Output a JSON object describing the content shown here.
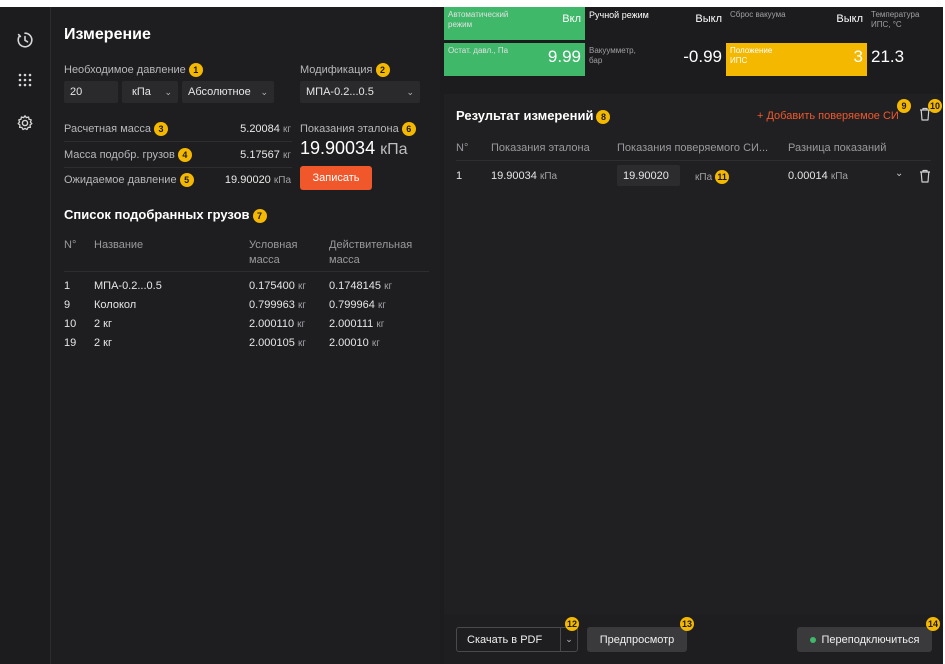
{
  "colors": {
    "accent": "#f0582c",
    "badge": "#f5b800",
    "green": "#3fb86a",
    "yellow": "#f5b800"
  },
  "sidebar": {
    "icons": [
      "timer-icon",
      "grid-icon",
      "settings-icon"
    ]
  },
  "measure": {
    "title": "Измерение",
    "pressure_label": "Необходимое давление",
    "pressure_badge": "1",
    "pressure_value": "20",
    "unit_value": "кПа",
    "mode_value": "Абсолютное",
    "modification_label": "Модификация",
    "modification_badge": "2",
    "modification_value": "МПА-0.2...0.5",
    "calc_mass_label": "Расчетная масса",
    "calc_mass_badge": "3",
    "calc_mass_value": "5.20084",
    "calc_mass_unit": "кг",
    "weights_mass_label": "Масса подобр. грузов",
    "weights_mass_badge": "4",
    "weights_mass_value": "5.17567",
    "weights_mass_unit": "кг",
    "expected_label": "Ожидаемое давление",
    "expected_badge": "5",
    "expected_value": "19.90020",
    "expected_unit": "кПа",
    "reference_label": "Показания эталона",
    "reference_badge": "6",
    "reference_value": "19.90034",
    "reference_unit": "кПа",
    "record_button": "Записать"
  },
  "weights": {
    "title": "Список подобранных грузов",
    "badge": "7",
    "headers": {
      "no": "N°",
      "name": "Название",
      "nominal": "Условная масса",
      "actual": "Действительная масса"
    },
    "rows": [
      {
        "no": "1",
        "name": "МПА-0.2...0.5",
        "nominal": "0.175400",
        "actual": "0.1748145",
        "unit": "кг"
      },
      {
        "no": "9",
        "name": "Колокол",
        "nominal": "0.799963",
        "actual": "0.799964",
        "unit": "кг"
      },
      {
        "no": "10",
        "name": "2 кг",
        "nominal": "2.000110",
        "actual": "2.000111",
        "unit": "кг"
      },
      {
        "no": "19",
        "name": "2 кг",
        "nominal": "2.000105",
        "actual": "2.00010",
        "unit": "кг"
      }
    ]
  },
  "status": {
    "auto_label": "Автоматический режим",
    "auto_value": "Вкл",
    "manual_label": "Ручной режим",
    "manual_value": "Выкл",
    "vacuum_reset_label": "Сброс вакуума",
    "vacuum_reset_value": "Выкл",
    "temp_label": "Температура ИПС, °С",
    "temp_value": "21.3",
    "residual_label": "Остат. давл., Па",
    "residual_value": "9.99",
    "vacuummeter_label": "Вакуумметр, бар",
    "vacuummeter_value": "-0.99",
    "position_label": "Положение ИПС",
    "position_value": "3"
  },
  "results": {
    "title": "Результат измерений",
    "badge": "8",
    "add_link": "+ Добавить поверяемое СИ",
    "add_badge": "9",
    "delete_badge": "10",
    "headers": {
      "no": "N°",
      "reference": "Показания эталона",
      "tested": "Показания поверяемого СИ...",
      "diff": "Разница показаний"
    },
    "rows": [
      {
        "no": "1",
        "reference": "19.90034",
        "reference_unit": "кПа",
        "tested": "19.90020",
        "tested_unit": "кПа",
        "tested_badge": "11",
        "diff": "0.00014",
        "diff_unit": "кПа"
      }
    ]
  },
  "footer": {
    "pdf_button": "Скачать в PDF",
    "pdf_badge": "12",
    "preview_button": "Предпросмотр",
    "preview_badge": "13",
    "reconnect_button": "Переподключиться",
    "reconnect_badge": "14"
  }
}
